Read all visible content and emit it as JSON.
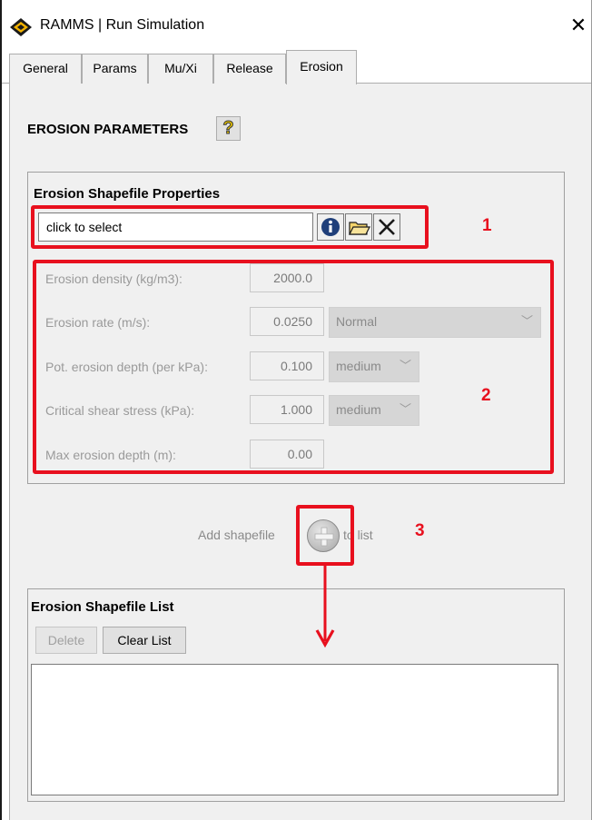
{
  "window": {
    "title": "RAMMS | Run Simulation",
    "close_glyph": "✕"
  },
  "tabs": [
    {
      "label": "General",
      "active": false
    },
    {
      "label": "Params",
      "active": false
    },
    {
      "label": "Mu/Xi",
      "active": false
    },
    {
      "label": "Release",
      "active": false
    },
    {
      "label": "Erosion",
      "active": true
    }
  ],
  "erosion": {
    "heading": "EROSION PARAMETERS",
    "help_glyph": "?",
    "shapefile_properties": {
      "title": "Erosion Shapefile Properties",
      "file_field_value": "click to select",
      "icons": [
        "info-icon",
        "open-folder-icon",
        "clear-x-icon"
      ]
    },
    "params": [
      {
        "label": "Erosion density (kg/m3):",
        "value": "2000.0"
      },
      {
        "label": "Erosion rate (m/s):",
        "value": "0.0250",
        "select": "Normal"
      },
      {
        "label": "Pot. erosion depth (per kPa):",
        "value": "0.100",
        "select": "medium"
      },
      {
        "label": "Critical shear stress (kPa):",
        "value": "1.000",
        "select": "medium"
      },
      {
        "label": "Max erosion depth (m):",
        "value": "0.00"
      }
    ],
    "add_shapefile": {
      "pre_label": "Add shapefile",
      "post_label": "to list"
    },
    "shapefile_list": {
      "title": "Erosion Shapefile List",
      "delete_label": "Delete",
      "clear_label": "Clear List",
      "items": []
    }
  },
  "annotations": {
    "label_1": "1",
    "label_2": "2",
    "label_3": "3",
    "color": "#e8101e"
  },
  "colors": {
    "panel_bg": "#f0f0f0",
    "annotation_red": "#e8101e"
  }
}
